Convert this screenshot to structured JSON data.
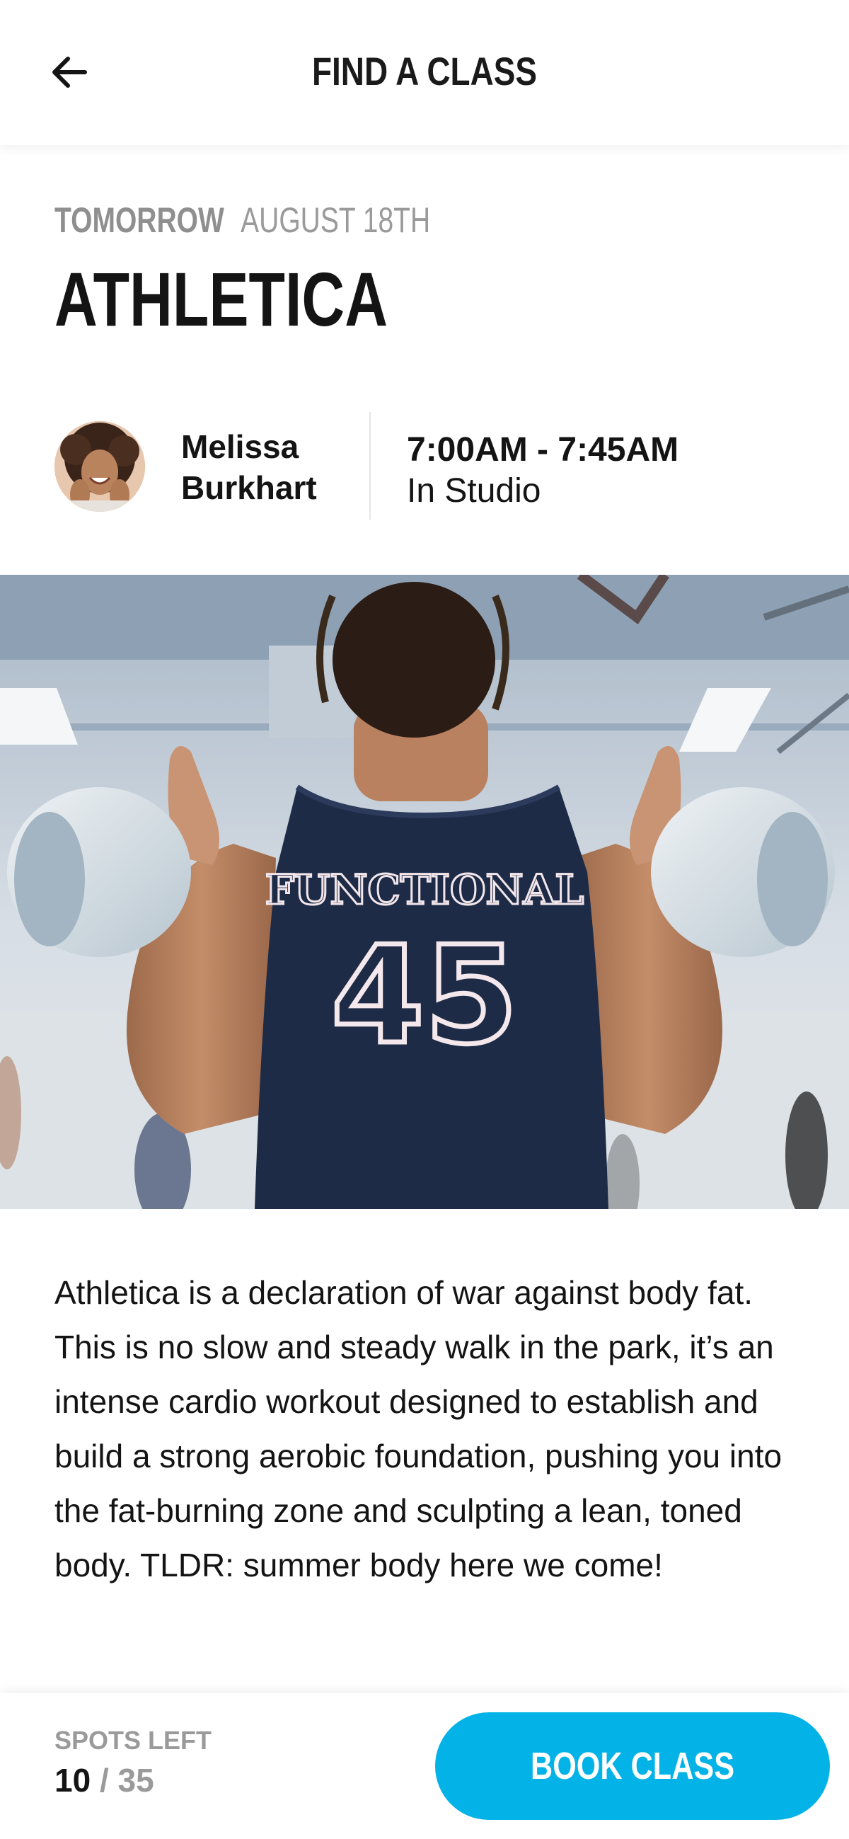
{
  "header": {
    "title": "FIND A CLASS",
    "back_icon": "arrow-left-icon"
  },
  "class": {
    "when": "TOMORROW",
    "date": "AUGUST 18TH",
    "name": "ATHLETICA",
    "instructor": {
      "first_name": "Melissa",
      "last_name": "Burkhart"
    },
    "time": "7:00AM - 7:45AM",
    "location": "In Studio",
    "jersey_text": "FUNCTIONAL",
    "jersey_number": "45",
    "description": "Athletica is a declaration of war against body fat. This is no slow and steady walk in the park, it’s an intense cardio workout designed to establish and build a strong aerobic foundation, pushing you into the fat-burning zone and sculpting a lean, toned body. TLDR: summer body here we come!"
  },
  "footer": {
    "spots_label": "SPOTS LEFT",
    "spots_left": "10",
    "spots_separator": "/",
    "spots_total": "35",
    "book_label": "BOOK CLASS"
  },
  "colors": {
    "accent": "#03b3e7",
    "muted_text": "#9a9a9a",
    "primary_text": "#141414",
    "jersey": "#1d2b47"
  }
}
